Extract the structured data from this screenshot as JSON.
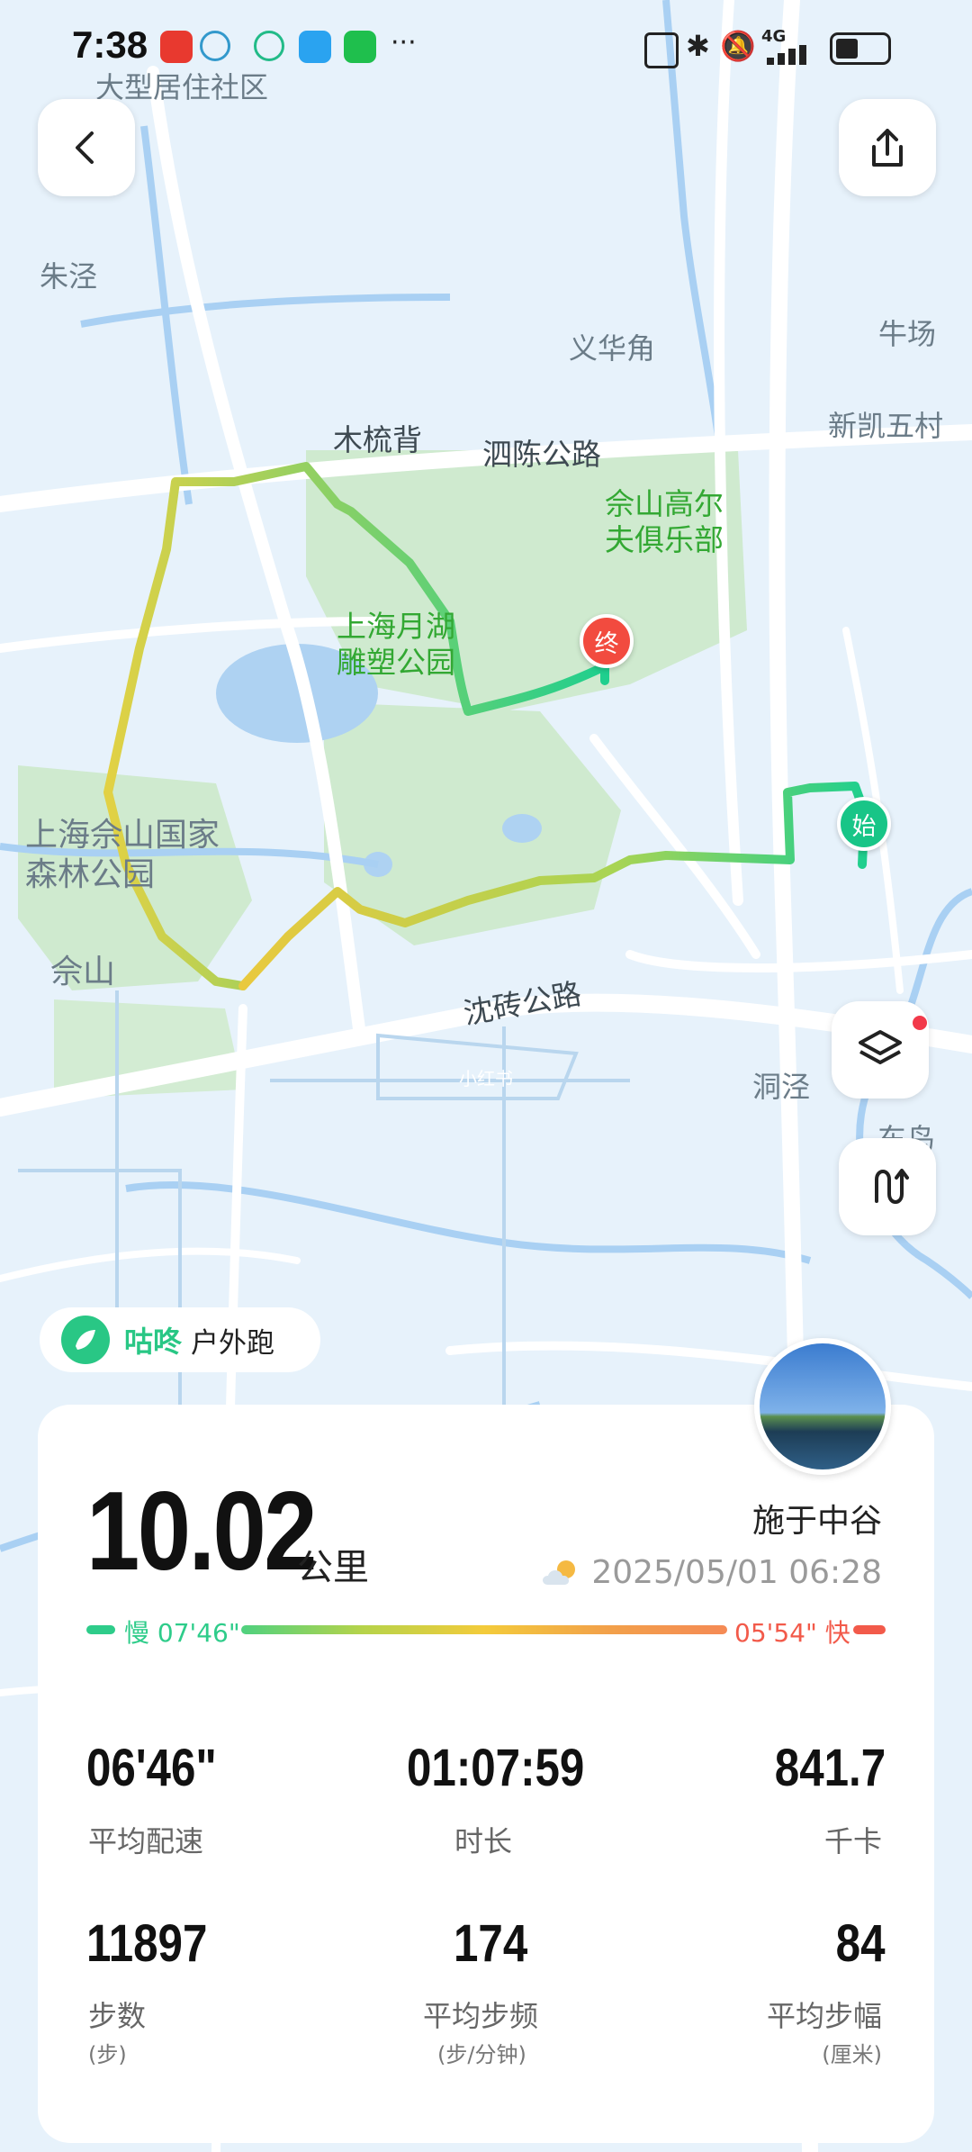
{
  "status_bar": {
    "time": "7:38",
    "more": "···",
    "network": "4G"
  },
  "map": {
    "labels": {
      "dax_community": "大型居住社区",
      "zhujing": "朱泾",
      "yihuajiao": "义华角",
      "niuchang": "牛场",
      "xinkai": "新凯五村",
      "mushubei": "木梳背",
      "sichen_road": "泗陈公路",
      "golf_club": "佘山高尔夫俱乐部",
      "yuehu_park": "上海月湖雕塑公园",
      "forest_park": "上海佘山国家森林公园",
      "sheshan": "佘山",
      "shenzhuan_road": "沈砖公路",
      "dongjing": "洞泾",
      "dongniao": "东鸟",
      "watermark": "小红书"
    },
    "start_label": "始",
    "end_label": "终",
    "route_colors": {
      "fast": "#1fcf8e",
      "mid": "#e9d24a",
      "slow": "#f0b63a"
    }
  },
  "brand": {
    "name": "咕咚",
    "mode": "户外跑"
  },
  "summary": {
    "distance": "10.02",
    "distance_unit": "公里",
    "location": "施于中谷",
    "datetime": "2025/05/01 06:28",
    "weather_icon": "partly-cloudy-icon",
    "pace_slow": "慢 07'46\"",
    "pace_fast": "05'54\" 快"
  },
  "stats": [
    {
      "value": "06'46\"",
      "label": "平均配速",
      "sub": ""
    },
    {
      "value": "01:07:59",
      "label": "时长",
      "sub": ""
    },
    {
      "value": "841.7",
      "label": "千卡",
      "sub": ""
    },
    {
      "value": "11897",
      "label": "步数",
      "sub": "(步)"
    },
    {
      "value": "174",
      "label": "平均步频",
      "sub": "(步/分钟)"
    },
    {
      "value": "84",
      "label": "平均步幅",
      "sub": "(厘米)"
    }
  ],
  "colors": {
    "accent": "#29c785",
    "slow_green": "#2ecc8a",
    "fast_red": "#f25a4a"
  }
}
